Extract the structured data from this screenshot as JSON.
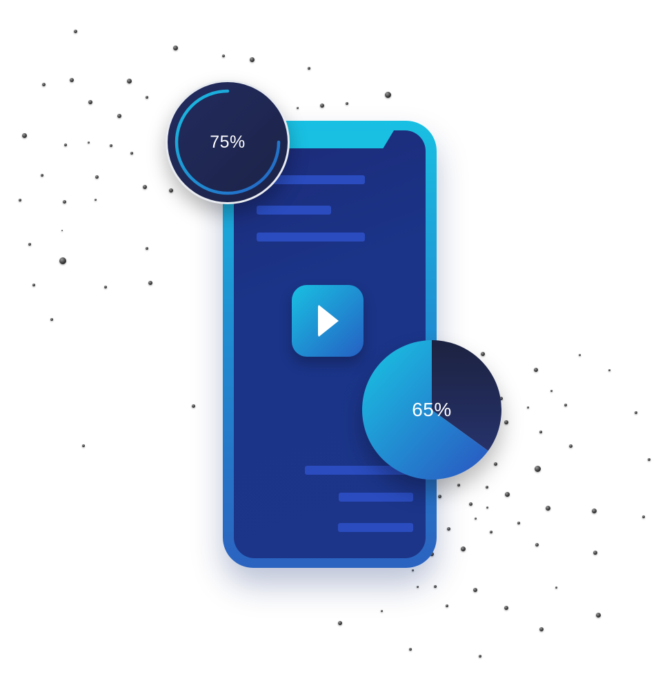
{
  "progress_ring": {
    "label": "75%",
    "value": 0.75
  },
  "pie_chart": {
    "label": "65%",
    "value": 0.65
  },
  "colors": {
    "phone_frame": "#19c0e2",
    "screen": "#1c3589",
    "content_bar": "#2a4cbe",
    "ring_bg": "#1f2a55",
    "ring_arc": "#19c0e2",
    "pie_dark": "#1f2850",
    "pie_light": "#19c0e2"
  },
  "icons": {
    "play": "play-icon"
  }
}
